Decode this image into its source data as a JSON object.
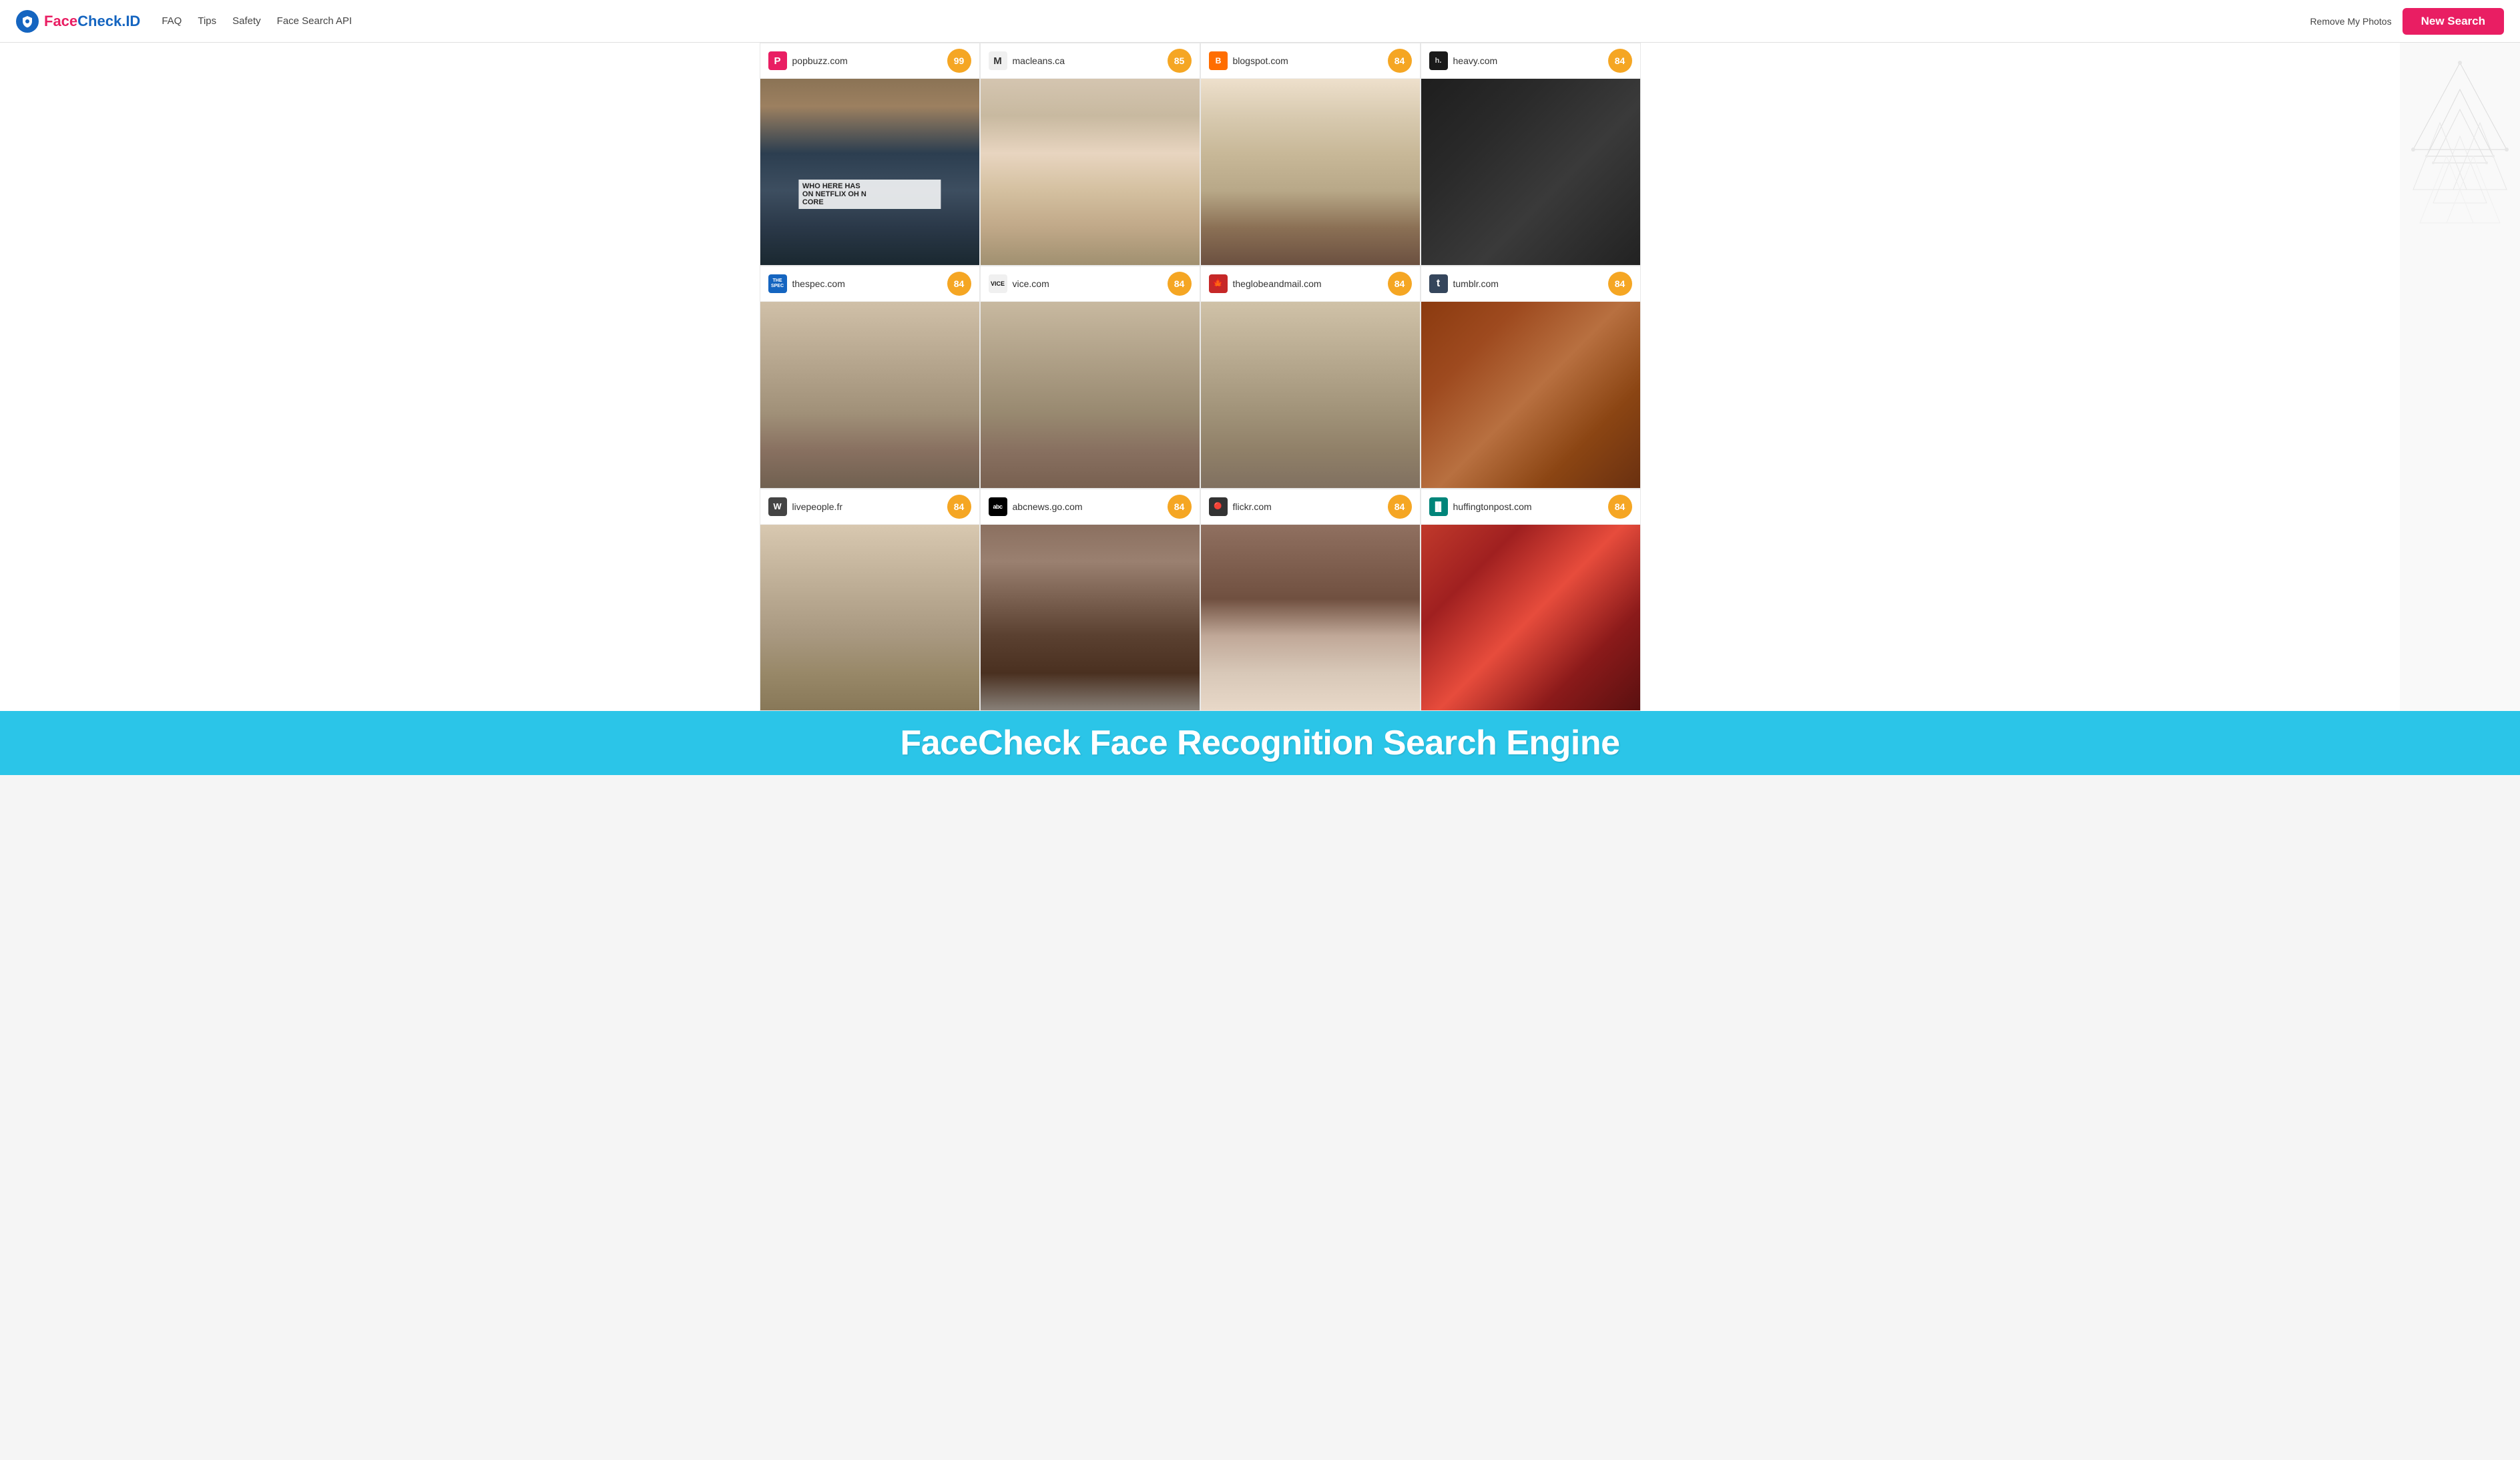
{
  "header": {
    "logo_text": "FaceCheck.ID",
    "logo_face": "Face",
    "logo_check": "Check",
    "logo_id": ".ID",
    "nav": [
      {
        "id": "faq",
        "label": "FAQ"
      },
      {
        "id": "tips",
        "label": "Tips"
      },
      {
        "id": "safety",
        "label": "Safety"
      },
      {
        "id": "api",
        "label": "Face Search API"
      }
    ],
    "remove_photos": "Remove My Photos",
    "new_search": "New Search"
  },
  "results": [
    {
      "id": "popbuzz",
      "site": "popbuzz.com",
      "score": "99",
      "favicon_letter": "P",
      "favicon_class": "favicon-popbuzz",
      "img_class": "img-popbuzz",
      "has_overlay_text": true,
      "overlay_line1": "WHO HERE HAS",
      "overlay_line2": "ON NETFLIX OH N",
      "overlay_line3": "CORE"
    },
    {
      "id": "macleans",
      "site": "macleans.ca",
      "score": "85",
      "favicon_letter": "M",
      "favicon_class": "favicon-macleans",
      "img_class": "img-macleans",
      "has_overlay_text": false
    },
    {
      "id": "blogspot",
      "site": "blogspot.com",
      "score": "84",
      "favicon_letter": "B",
      "favicon_class": "favicon-blogspot",
      "img_class": "img-blogspot",
      "has_overlay_text": false
    },
    {
      "id": "heavy",
      "site": "heavy.com",
      "score": "84",
      "favicon_letter": "h.",
      "favicon_class": "favicon-heavy",
      "img_class": "img-heavy",
      "has_overlay_text": false
    },
    {
      "id": "thespec",
      "site": "thespec.com",
      "score": "84",
      "favicon_letter": "THE SPEC",
      "favicon_class": "favicon-thespec",
      "img_class": "img-thespec",
      "has_overlay_text": false
    },
    {
      "id": "vice",
      "site": "vice.com",
      "score": "84",
      "favicon_letter": "VICE",
      "favicon_class": "favicon-vice",
      "img_class": "img-vice",
      "has_overlay_text": false
    },
    {
      "id": "globe",
      "site": "theglobeandmail.com",
      "score": "84",
      "favicon_letter": "🍁",
      "favicon_class": "favicon-globe",
      "img_class": "img-globe",
      "has_overlay_text": false
    },
    {
      "id": "tumblr",
      "site": "tumblr.com",
      "score": "84",
      "favicon_letter": "t",
      "favicon_class": "favicon-tumblr",
      "img_class": "img-tumblr",
      "has_overlay_text": false
    },
    {
      "id": "livepeople",
      "site": "livepeople.fr",
      "score": "84",
      "favicon_letter": "W",
      "favicon_class": "favicon-livepeople",
      "img_class": "img-livepeople",
      "has_overlay_text": false
    },
    {
      "id": "abcnews",
      "site": "abcnews.go.com",
      "score": "84",
      "favicon_letter": "abc",
      "favicon_class": "favicon-abcnews",
      "img_class": "img-abcnews",
      "has_overlay_text": false
    },
    {
      "id": "flickr",
      "site": "flickr.com",
      "score": "84",
      "favicon_letter": "●●",
      "favicon_class": "favicon-flickr",
      "img_class": "img-flickr",
      "has_overlay_text": false
    },
    {
      "id": "huffpost",
      "site": "huffingtonpost.com",
      "score": "84",
      "favicon_letter": "▐▌",
      "favicon_class": "favicon-huffpost",
      "img_class": "img-huffpost",
      "has_overlay_text": false
    }
  ],
  "banner": {
    "text": "FaceCheck Face Recognition Search Engine"
  },
  "colors": {
    "accent_pink": "#e91e63",
    "accent_blue": "#1565c0",
    "score_orange": "#f5a623",
    "banner_blue": "#2BC5E8"
  }
}
